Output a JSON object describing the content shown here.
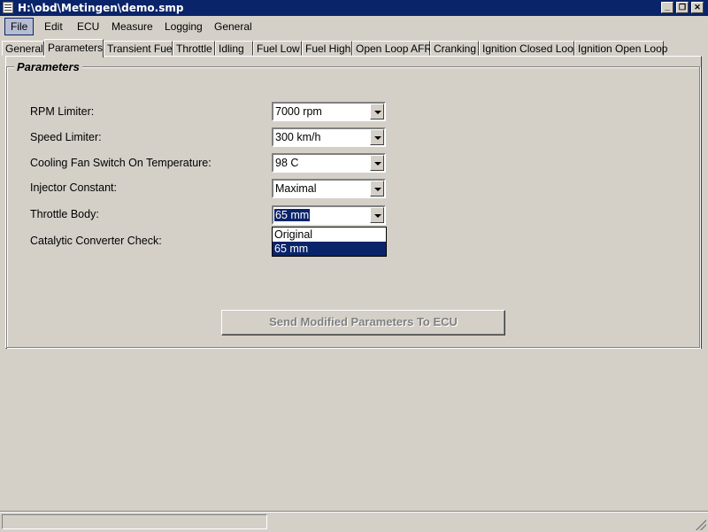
{
  "window": {
    "title": "H:\\obd\\Metingen\\demo.smp",
    "minimize_glyph": "_",
    "maximize_glyph": "❐",
    "close_glyph": "✕"
  },
  "menu": [
    "File",
    "Edit",
    "ECU",
    "Measure",
    "Logging",
    "General"
  ],
  "tabs": [
    "General",
    "Parameters",
    "Transient Fuel",
    "Throttle",
    "Idling",
    "Fuel Low",
    "Fuel High",
    "Open Loop AFR",
    "Cranking",
    "Ignition Closed Loop",
    "Ignition Open Loop"
  ],
  "selected_tab": "Parameters",
  "group": {
    "title": "Parameters"
  },
  "params": [
    {
      "label": "RPM Limiter:",
      "value": "7000 rpm"
    },
    {
      "label": "Speed Limiter:",
      "value": "300 km/h"
    },
    {
      "label": "Cooling Fan Switch On Temperature:",
      "value": "98 C"
    },
    {
      "label": "Injector Constant:",
      "value": "Maximal"
    },
    {
      "label": "Throttle Body:",
      "value": "65 mm"
    },
    {
      "label": "Catalytic Converter Check:",
      "value": ""
    }
  ],
  "dropdown": {
    "options": [
      "Original",
      "65 mm"
    ],
    "selected": "65 mm"
  },
  "send_button": "Send Modified Parameters To ECU",
  "colors": {
    "titlebar": "#0a246a",
    "face": "#d4d0c8",
    "highlight": "#0a246a"
  }
}
